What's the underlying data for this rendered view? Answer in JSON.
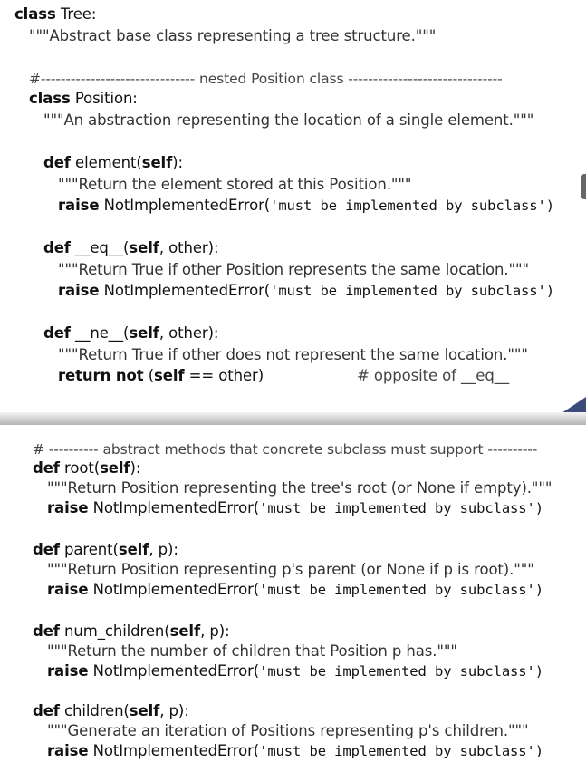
{
  "top": {
    "class_kw": "class",
    "class_name": " Tree:",
    "class_doc": "\"\"\"Abstract base class representing a tree structure.\"\"\"",
    "nested_comment": "#------------------------------- nested Position class -------------------------------",
    "pos_kw": "class",
    "pos_name": " Position:",
    "pos_doc": "\"\"\"An abstraction representing the location of a single element.\"\"\"",
    "m1_def": "def",
    "m1_name": " element(",
    "m1_self": "self",
    "m1_tail": "):",
    "m1_doc": "\"\"\"Return the element stored at this Position.\"\"\"",
    "m1_raise": "raise",
    "m1_err": " NotImplementedError(",
    "m1_str": "'must be implemented by subclass')",
    "m2_def": "def",
    "m2_name": " __eq__(",
    "m2_self": "self",
    "m2_tail": ", other):",
    "m2_doc": "\"\"\"Return True if other Position represents the same location.\"\"\"",
    "m2_raise": "raise",
    "m2_err": " NotImplementedError(",
    "m2_str": "'must be implemented by subclass')",
    "m3_def": "def",
    "m3_name": " __ne__(",
    "m3_self": "self",
    "m3_tail": ", other):",
    "m3_doc": "\"\"\"Return True if other does not represent the same location.\"\"\"",
    "m3_return": "return not",
    "m3_open": " (",
    "m3_self2": "self",
    "m3_cmp": " == other)",
    "m3_comment": "# opposite of __eq__"
  },
  "bottom": {
    "abstract_comment": "# ---------- abstract methods that concrete subclass must support ----------",
    "m4_def": "def",
    "m4_name": " root(",
    "m4_self": "self",
    "m4_tail": "):",
    "m4_doc": "\"\"\"Return Position representing the tree's root (or None if empty).\"\"\"",
    "m4_raise": "raise",
    "m4_err": " NotImplementedError(",
    "m4_str": "'must be implemented by subclass')",
    "m5_def": "def",
    "m5_name": " parent(",
    "m5_self": "self",
    "m5_tail": ", p):",
    "m5_doc": "\"\"\"Return Position representing p's parent (or None if p is root).\"\"\"",
    "m5_raise": "raise",
    "m5_err": " NotImplementedError(",
    "m5_str": "'must be implemented by subclass')",
    "m6_def": "def",
    "m6_name": " num_children(",
    "m6_self": "self",
    "m6_tail": ", p):",
    "m6_doc": "\"\"\"Return the number of children that Position p has.\"\"\"",
    "m6_raise": "raise",
    "m6_err": " NotImplementedError(",
    "m6_str": "'must be implemented by subclass')",
    "m7_def": "def",
    "m7_name": " children(",
    "m7_self": "self",
    "m7_tail": ", p):",
    "m7_doc": "\"\"\"Generate an iteration of Positions representing p's children.\"\"\"",
    "m7_raise": "raise",
    "m7_err": " NotImplementedError(",
    "m7_str": "'must be implemented by subclass')"
  }
}
